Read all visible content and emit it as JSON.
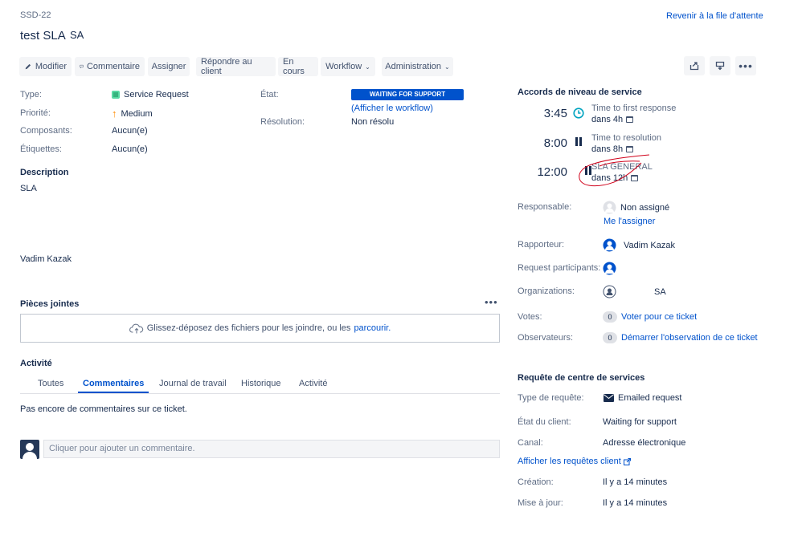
{
  "header": {
    "issue_key": "SSD-22",
    "title": "test SLA",
    "org": "SA",
    "back_link": "Revenir à la file d'attente"
  },
  "toolbar": {
    "edit": "Modifier",
    "comment": "Commentaire",
    "assign": "Assigner",
    "reply": "Répondre au client",
    "in_progress": "En cours",
    "workflow": "Workflow",
    "admin": "Administration"
  },
  "details": {
    "type_label": "Type:",
    "type_value": "Service Request",
    "priority_label": "Priorité:",
    "priority_value": "Medium",
    "components_label": "Composants:",
    "components_value": "Aucun(e)",
    "labels_label": "Étiquettes:",
    "labels_value": "Aucun(e)",
    "status_label": "État:",
    "status_value": "WAITING FOR SUPPORT",
    "show_workflow": "(Afficher le workflow)",
    "resolution_label": "Résolution:",
    "resolution_value": "Non résolu"
  },
  "description": {
    "title": "Description",
    "line1": "SLA",
    "signature": "Vadim Kazak"
  },
  "attachments": {
    "title": "Pièces jointes",
    "drop_text": "Glissez-déposez des fichiers pour les joindre, ou les",
    "browse": "parcourir."
  },
  "activity": {
    "title": "Activité",
    "tabs": [
      "Toutes",
      "Commentaires",
      "Journal de travail",
      "Historique",
      "Activité"
    ],
    "active_tab": "Commentaires",
    "empty": "Pas encore de commentaires sur ce ticket.",
    "comment_placeholder": "Cliquer pour ajouter un commentaire."
  },
  "sla": {
    "title": "Accords de niveau de service",
    "items": [
      {
        "time": "3:45",
        "name": "Time to first response",
        "due": "dans 4h",
        "state": "running"
      },
      {
        "time": "8:00",
        "name": "Time to resolution",
        "due": "dans 8h",
        "state": "paused"
      },
      {
        "time": "12:00",
        "name": "SLA GENERAL",
        "due": "dans 12h",
        "state": "paused"
      }
    ]
  },
  "people": {
    "assignee_label": "Responsable:",
    "assignee_value": "Non assigné",
    "assign_me": "Me l'assigner",
    "reporter_label": "Rapporteur:",
    "reporter_value": "Vadim Kazak",
    "participants_label": "Request participants:",
    "orgs_label": "Organizations:",
    "orgs_value": "SA",
    "votes_label": "Votes:",
    "votes_count": "0",
    "votes_action": "Voter pour ce ticket",
    "watchers_label": "Observateurs:",
    "watchers_count": "0",
    "watchers_action": "Démarrer l'observation de ce ticket"
  },
  "service_request": {
    "title": "Requête de centre de services",
    "type_label": "Type de requête:",
    "type_value": "Emailed request",
    "client_state_label": "État du client:",
    "client_state_value": "Waiting for support",
    "channel_label": "Canal:",
    "channel_value": "Adresse électronique",
    "view_requests": "Afficher les requêtes client",
    "created_label": "Création:",
    "created_value": "Il y a 14 minutes",
    "updated_label": "Mise à jour:",
    "updated_value": "Il y a 14 minutes"
  },
  "colors": {
    "link": "#0052cc",
    "status_bg": "#0052cc",
    "priority": "#ff8b00",
    "request_type": "#36b37e",
    "annotation": "#d0021b"
  }
}
